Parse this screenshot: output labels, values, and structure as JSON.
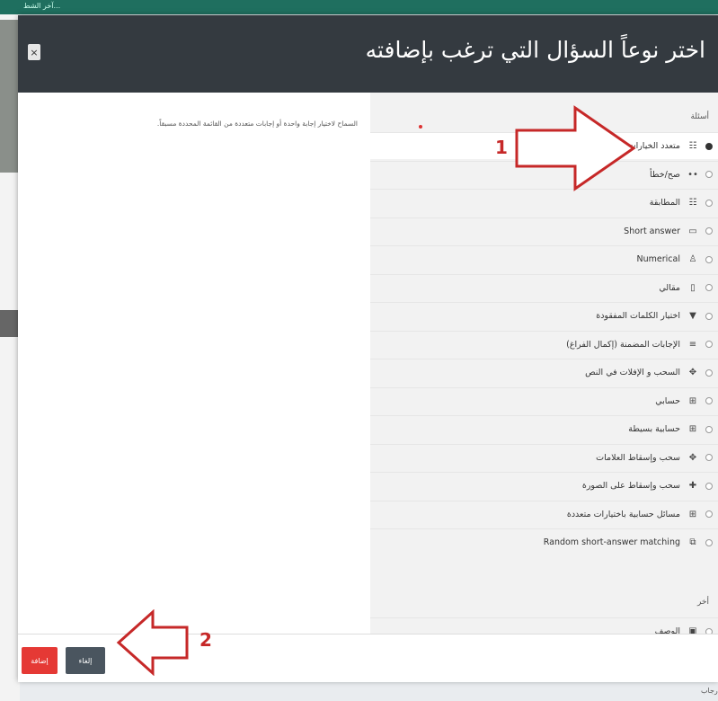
{
  "background": {
    "topbar_text": "آخر الشط...",
    "bottom_text": "رجاب"
  },
  "modal": {
    "title": "اختر نوعاً السؤال التي ترغب بإضافته",
    "close_label": "×",
    "description": "السماح لاختيار إجابة واحدة أو إجابات متعددة من القائمة المحددة مسبقاً.",
    "questions_heading": "أسئلة",
    "other_heading": "أخر",
    "questions": [
      {
        "label": "متعدد الخيارات",
        "icon": "list-icon",
        "glyph": "☷",
        "selected": true
      },
      {
        "label": "صح/خطأ",
        "icon": "dots-icon",
        "glyph": "••",
        "selected": false
      },
      {
        "label": "المطابقة",
        "icon": "grid-icon",
        "glyph": "☷",
        "selected": false
      },
      {
        "label": "Short answer",
        "icon": "input-box-icon",
        "glyph": "▭",
        "selected": false
      },
      {
        "label": "Numerical",
        "icon": "numeric-icon",
        "glyph": "♙",
        "selected": false
      },
      {
        "label": "مقالي",
        "icon": "document-icon",
        "glyph": "▯",
        "selected": false
      },
      {
        "label": "اختيار الكلمات المفقودة",
        "icon": "dropdown-icon",
        "glyph": "▼",
        "selected": false
      },
      {
        "label": "الإجابات المضمنة (إكمال الفراغ)",
        "icon": "cloze-icon",
        "glyph": "≡",
        "selected": false
      },
      {
        "label": "السحب و الإفلات في النص",
        "icon": "drag-text-icon",
        "glyph": "✥",
        "selected": false
      },
      {
        "label": "حسابي",
        "icon": "calculator-icon",
        "glyph": "⊞",
        "selected": false
      },
      {
        "label": "حسابية بسيطة",
        "icon": "calculator-simple-icon",
        "glyph": "⊞",
        "selected": false
      },
      {
        "label": "سحب وإسقاط العلامات",
        "icon": "drag-markers-icon",
        "glyph": "✥",
        "selected": false
      },
      {
        "label": "سحب وإسقاط على الصورة",
        "icon": "drag-image-icon",
        "glyph": "✚",
        "selected": false
      },
      {
        "label": "مسائل حسابية باختيارات متعددة",
        "icon": "calculator-multi-icon",
        "glyph": "⊞",
        "selected": false
      },
      {
        "label": "Random short-answer matching",
        "icon": "random-icon",
        "glyph": "⧉",
        "selected": false
      }
    ],
    "other": [
      {
        "label": "الوصف",
        "icon": "description-icon",
        "glyph": "▣",
        "selected": false
      }
    ],
    "add_button": "إضافة",
    "cancel_button": "إلغاء"
  },
  "annotations": {
    "step1": "1",
    "step2": "2",
    "arrow_color": "#c62828"
  }
}
